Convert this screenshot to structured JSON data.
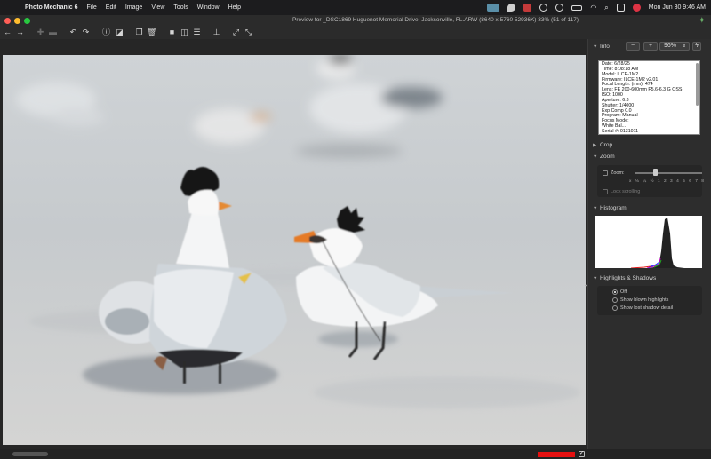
{
  "menubar": {
    "app_name": "Photo Mechanic 6",
    "items": [
      "File",
      "Edit",
      "Image",
      "View",
      "Tools",
      "Window",
      "Help"
    ],
    "clock": "Mon Jun 30  9:46 AM"
  },
  "window": {
    "title": "Preview for  _DSC1869 Huguenot Memorial Drive, Jacksonville, FL.ARW (8640 x 5760 52936K) 33% (51 of 117)"
  },
  "panel": {
    "info_label": "Info",
    "zoom_minus": "−",
    "zoom_plus": "+",
    "zoom_value": "96%",
    "info_lines": [
      "Date: 6/28/25",
      "Time: 8:08:18 AM",
      "Model: ILCE-1M2",
      "Firmware: ILCE-1M2 v2.01",
      "Focal Length:  (mm): 474",
      "Lens: FE 200-600mm F5.6-6.3 G OSS",
      "ISO: 1000",
      "Aperture: 6.3",
      "Shutter: 1/4000",
      "Exp Comp 0.0",
      "Program: Manual",
      "Focus Mode:",
      "White Bal...",
      "Serial #: 0131011"
    ],
    "crop_label": "Crop",
    "zoom_section_label": "Zoom",
    "zoom_check_label": "Zoom:",
    "zoom_ticks": [
      "x",
      "⅛",
      "¼",
      "½",
      "1",
      "2",
      "3",
      "4",
      "5",
      "6",
      "7",
      "8"
    ],
    "lock_scrolling": "Lock scrolling",
    "histogram_label": "Histogram",
    "hs_label": "Highlights & Shadows",
    "hs_options": [
      "Off",
      "Show blown highlights",
      "Show lost shadow detail"
    ],
    "hs_selected": "Off"
  }
}
